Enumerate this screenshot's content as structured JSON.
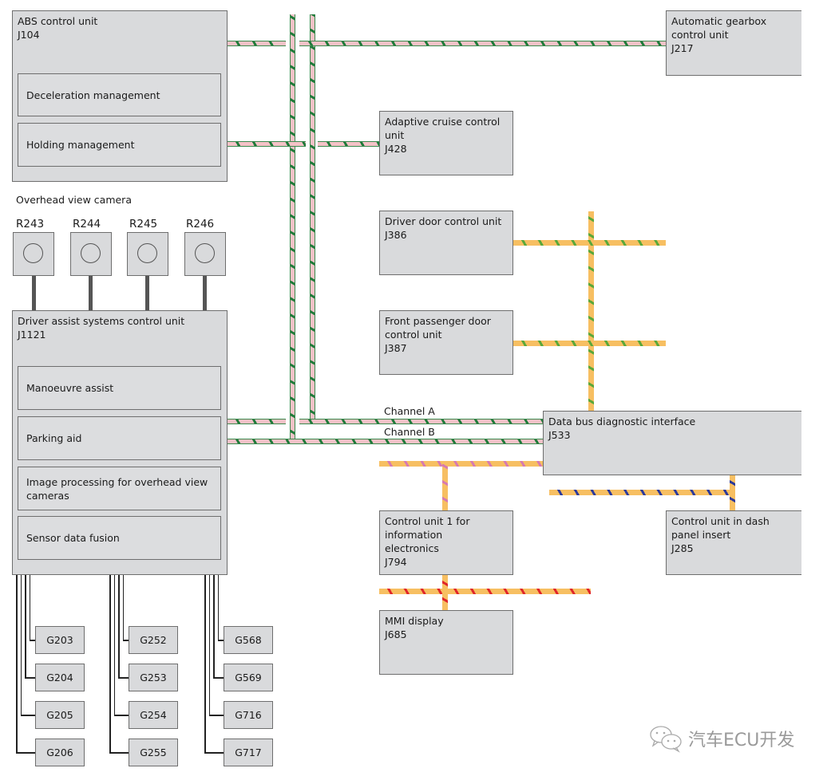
{
  "units": {
    "abs": {
      "title": "ABS control unit\nJ104",
      "functions": [
        "Deceleration management",
        "Holding management"
      ]
    },
    "gearbox": {
      "title": "Automatic gearbox\ncontrol unit\nJ217"
    },
    "acc": {
      "title": "Adaptive cruise control\nunit\nJ428"
    },
    "driver_door": {
      "title": "Driver door control unit\nJ386"
    },
    "passenger_door": {
      "title": "Front passenger door\ncontrol unit\nJ387"
    },
    "gateway": {
      "title": "Data bus diagnostic interface\nJ533"
    },
    "info_electronics": {
      "title": "Control unit 1 for\ninformation\nelectronics\nJ794"
    },
    "mmi_display": {
      "title": "MMI display\nJ685"
    },
    "dash_panel": {
      "title": "Control unit in dash\npanel insert\nJ285"
    },
    "driver_assist": {
      "title": "Driver assist systems control unit\nJ1121",
      "functions": [
        "Manoeuvre assist",
        "Parking aid",
        "Image processing for overhead view\ncameras",
        "Sensor data fusion"
      ]
    }
  },
  "cameras": {
    "heading": "Overhead view camera",
    "items": [
      "R243",
      "R244",
      "R245",
      "R246"
    ]
  },
  "sensors": {
    "groups": [
      [
        "G203",
        "G204",
        "G205",
        "G206"
      ],
      [
        "G252",
        "G253",
        "G254",
        "G255"
      ],
      [
        "G568",
        "G569",
        "G716",
        "G717"
      ]
    ]
  },
  "bus_labels": {
    "channel_a": "Channel A",
    "channel_b": "Channel B"
  },
  "bus_colors": {
    "fa_can": [
      "#f4c2c7",
      "#1f7a3a"
    ],
    "comfort_can": [
      "#f7bf62",
      "#5aa83a"
    ],
    "infotainment_can": [
      "#f7bf62",
      "#d77ab0"
    ],
    "dash_can": [
      "#f7bf62",
      "#2d3a9a"
    ],
    "display_can": [
      "#f7bf62",
      "#e0262a"
    ]
  },
  "watermark": {
    "icon": "wechat-icon",
    "text": "汽车ECU开发"
  }
}
